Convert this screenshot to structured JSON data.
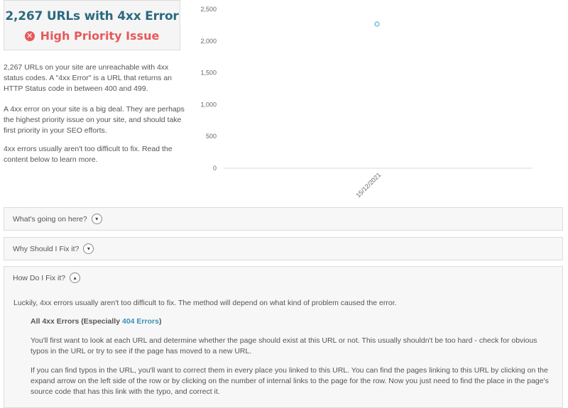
{
  "summary": {
    "title": "2,267 URLs with 4xx Error",
    "priority_label": "High Priority Issue",
    "priority_icon": "x-circle-icon",
    "priority_color": "#e8595a",
    "title_color": "#2b6a80"
  },
  "description": [
    "2,267 URLs on your site are unreachable with 4xx status codes. A \"4xx Error\" is a URL that returns an HTTP Status code in between 400 and 499.",
    "A 4xx error on your site is a big deal. They are perhaps the highest priority issue on your site, and should take first priority in your SEO efforts.",
    "4xx errors usually aren't too difficult to fix. Read the content below to learn more."
  ],
  "chart_data": {
    "type": "scatter",
    "x": [
      "15/12/2021"
    ],
    "y": [
      2267
    ],
    "y_ticks": [
      "2,500",
      "2,000",
      "1,500",
      "1,000",
      "500",
      "0"
    ],
    "ylim": [
      0,
      2500
    ],
    "marker_color": "#5aaed6",
    "grid": false
  },
  "sections": [
    {
      "label": "What's going on here?",
      "icon": "chevron-down-icon",
      "expanded": false
    },
    {
      "label": "Why Should I Fix it?",
      "icon": "chevron-down-icon",
      "expanded": false
    },
    {
      "label": "How Do I Fix it?",
      "icon": "chevron-up-icon",
      "expanded": true
    }
  ],
  "fix": {
    "intro": "Luckily, 4xx errors usually aren't too difficult to fix. The method will depend on what kind of problem caused the error.",
    "subheading_prefix": "All 4xx Errors (Especially ",
    "subheading_link": "404 Errors",
    "subheading_suffix": ")",
    "para1": "You'll first want to look at each URL and determine whether the page should exist at this URL or not. This usually shouldn't be too hard - check for obvious typos in the URL or try to see if the page has moved to a new URL.",
    "para2": "If you can find typos in the URL, you'll want to correct them in every place you linked to this URL. You can find the pages linking to this URL by clicking on the expand arrow on the left side of the row or by clicking on the number of internal links to the page for the row. Now you just need to find the place in the page's source code that has this link with the typo, and correct it."
  }
}
